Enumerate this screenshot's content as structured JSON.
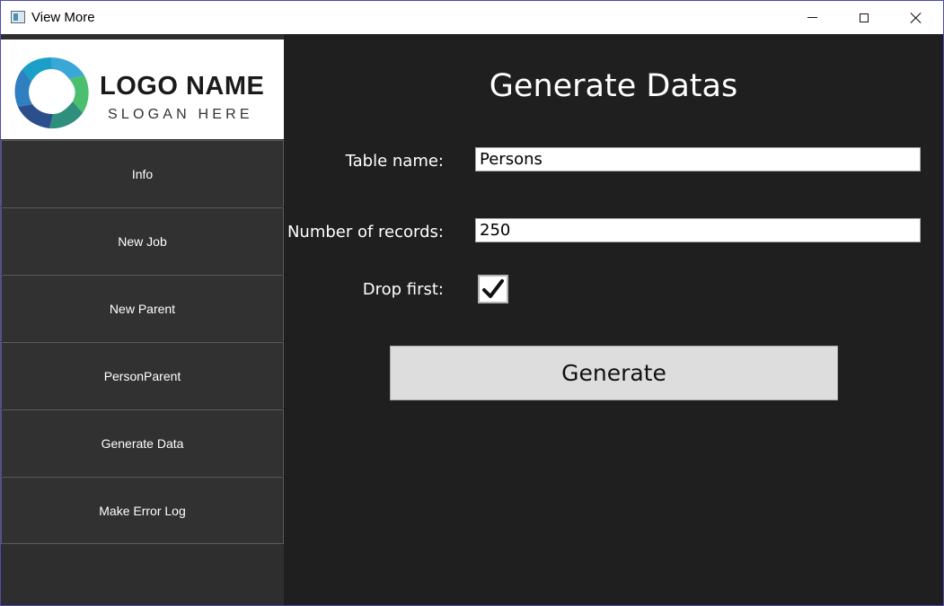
{
  "window": {
    "title": "View More",
    "icons": [
      "app-icon",
      "minimize-icon",
      "maximize-icon",
      "close-icon"
    ]
  },
  "sidebar": {
    "logo": {
      "name": "LOGO NAME",
      "slogan": "SLOGAN HERE"
    },
    "items": [
      {
        "label": "Info"
      },
      {
        "label": "New Job"
      },
      {
        "label": "New Parent"
      },
      {
        "label": "PersonParent"
      },
      {
        "label": "Generate Data"
      },
      {
        "label": "Make Error Log"
      }
    ]
  },
  "main": {
    "title": "Generate Datas",
    "table_name": {
      "label": "Table name:",
      "value": "Persons"
    },
    "records": {
      "label": "Number of records:",
      "value": "250"
    },
    "drop_first": {
      "label": "Drop first:",
      "checked": true
    },
    "generate_label": "Generate"
  },
  "colors": {
    "sidebar_bg": "#2e2e2e",
    "main_bg": "#1f1f1f",
    "button_bg": "#dddddd",
    "window_border": "#4c4ab0"
  }
}
